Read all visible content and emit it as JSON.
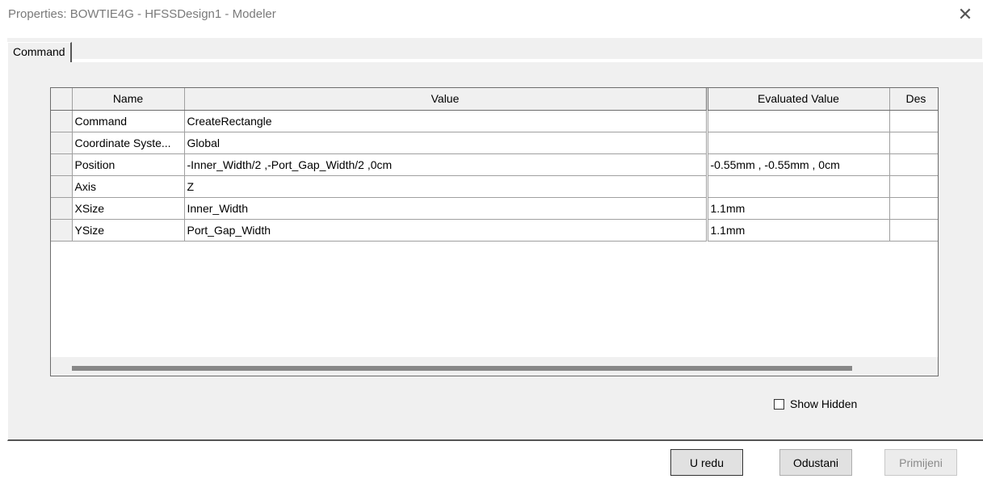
{
  "window": {
    "title": "Properties: BOWTIE4G - HFSSDesign1 - Modeler",
    "close_symbol": "✕"
  },
  "tabs": [
    {
      "label": "Command",
      "selected": true
    }
  ],
  "grid": {
    "columns": [
      "Name",
      "Value",
      "Evaluated Value",
      "Des"
    ],
    "rows": [
      {
        "name": "Command",
        "value": "CreateRectangle",
        "evaluated": "",
        "description": ""
      },
      {
        "name": "Coordinate Syste...",
        "value": "Global",
        "evaluated": "",
        "description": ""
      },
      {
        "name": "Position",
        "value": "-Inner_Width/2 ,-Port_Gap_Width/2 ,0cm",
        "evaluated": "-0.55mm , -0.55mm , 0cm",
        "description": ""
      },
      {
        "name": "Axis",
        "value": "Z",
        "evaluated": "",
        "description": ""
      },
      {
        "name": "XSize",
        "value": "Inner_Width",
        "evaluated": "1.1mm",
        "description": ""
      },
      {
        "name": "YSize",
        "value": "Port_Gap_Width",
        "evaluated": "1.1mm",
        "description": ""
      }
    ]
  },
  "options": {
    "show_hidden_label": "Show Hidden",
    "show_hidden_checked": false
  },
  "buttons": {
    "ok": "U redu",
    "cancel": "Odustani",
    "apply": "Primijeni"
  }
}
